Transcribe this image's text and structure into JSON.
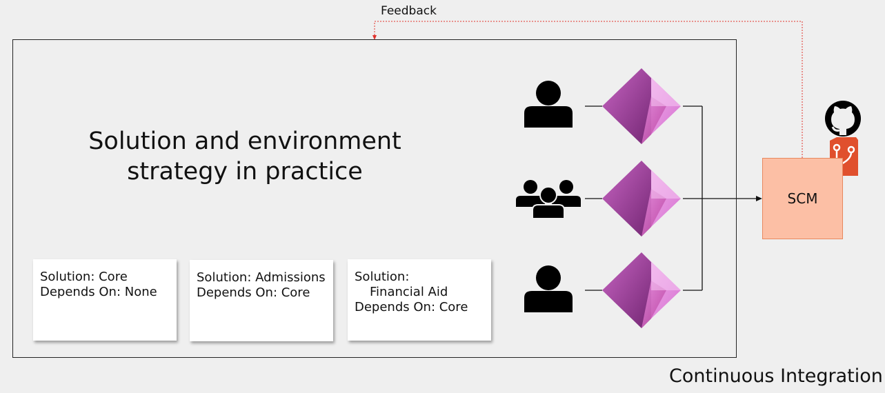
{
  "title": {
    "line1": "Solution and environment",
    "line2": "strategy in practice"
  },
  "solutions": [
    {
      "line1": "Solution: Core",
      "line2": "Depends On: None"
    },
    {
      "line1": "Solution: Admissions",
      "line2": "Depends On: Core"
    },
    {
      "line1": "Solution:",
      "line2": "Financial Aid",
      "line3": "Depends On: Core"
    }
  ],
  "scm": {
    "label": "SCM"
  },
  "feedback": {
    "label": "Feedback"
  },
  "pipeline": {
    "label": "Continuous Integration"
  },
  "icons": {
    "people": [
      "person-icon",
      "team-icon",
      "person-icon"
    ],
    "app": "power-apps-icon",
    "repos": [
      "github-icon",
      "azure-repos-icon"
    ]
  },
  "colors": {
    "feedback_arrow": "#e0302a",
    "scm_fill": "#fcbfa5",
    "scm_border": "#e8885e",
    "power_apps_dark": "#742774",
    "power_apps_light": "#e59ae0",
    "azure_repos": "#e0502d"
  }
}
